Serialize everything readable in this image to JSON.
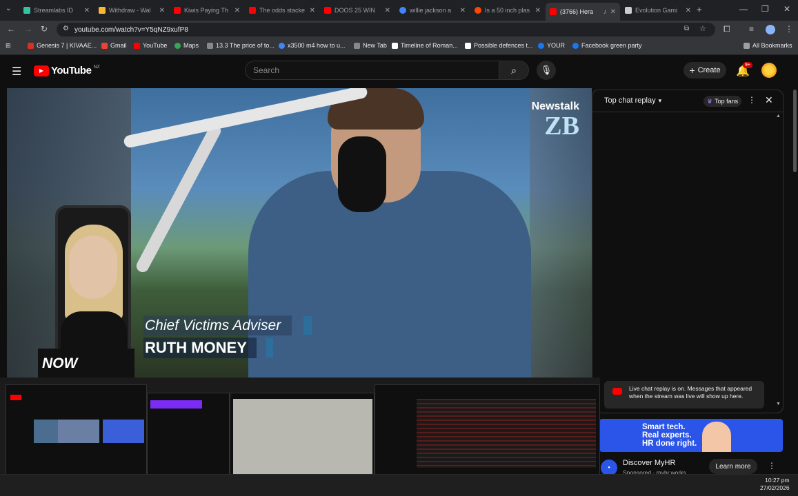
{
  "browser": {
    "tabs": [
      {
        "title": "Streamlabs ID",
        "color": "#31c3a2"
      },
      {
        "title": "Withdraw - Wal",
        "color": "#f7b731"
      },
      {
        "title": "Kiwis Paying Th",
        "color": "#ff0000"
      },
      {
        "title": "The odds stacke",
        "color": "#ff0000"
      },
      {
        "title": "DOOS 25 WIN",
        "color": "#ff0000"
      },
      {
        "title": "willie jackson a",
        "color": "#4285f4"
      },
      {
        "title": "Is a 50 inch plas",
        "color": "#ff4500"
      },
      {
        "title": "(3766) Hera",
        "color": "#ff0000"
      },
      {
        "title": "Evolution Gami",
        "color": "#ffffff"
      }
    ],
    "url": "youtube.com/watch?v=Y5qNZ9xufP8",
    "bookmarks": [
      {
        "label": "Genesis 7 | KIVAAE...",
        "color": "#d93025"
      },
      {
        "label": "Gmail",
        "color": "#ea4335"
      },
      {
        "label": "YouTube",
        "color": "#ff0000"
      },
      {
        "label": "Maps",
        "color": "#34a853"
      },
      {
        "label": "13.3 The price of to...",
        "color": "#888888"
      },
      {
        "label": "x3500 m4 how to u...",
        "color": "#4285f4"
      },
      {
        "label": "New Tab",
        "color": "#888888"
      },
      {
        "label": "Timeline of Roman...",
        "color": "#ffffff"
      },
      {
        "label": "Possible defences t...",
        "color": "#ffffff"
      },
      {
        "label": "YOUR",
        "color": "#1877f2"
      },
      {
        "label": "Facebook green party",
        "color": "#1877f2"
      }
    ],
    "all_bookmarks": "All Bookmarks"
  },
  "youtube": {
    "logo": "YouTube",
    "region": "NZ",
    "search_placeholder": "Search",
    "create_label": "Create",
    "notifications": "9+"
  },
  "video": {
    "channel_logo_line1": "Newstalk",
    "channel_logo_line2": "ZB",
    "lower_third_title": "Chief Victims Adviser",
    "lower_third_name": "RUTH MONEY",
    "now_badge": "NOW"
  },
  "chat": {
    "title": "Top chat replay",
    "top_fans_label": "Top fans",
    "notice": "Live chat replay is on. Messages that appeared when the stream was live will show up here."
  },
  "ad": {
    "banner_text": [
      "Smart tech.",
      "Real experts.",
      "HR done right."
    ],
    "title": "Discover MyHR",
    "sponsor": "Sponsored · myhr.works",
    "cta": "Learn more"
  },
  "taskbar": {
    "time": "10:27 pm",
    "date": "27/02/2026"
  },
  "colors": {
    "youtube_red": "#ff0000",
    "background": "#0f0f0f",
    "lower_third_accent": "#2c6e9c",
    "ad_blue": "#2a55e8"
  }
}
